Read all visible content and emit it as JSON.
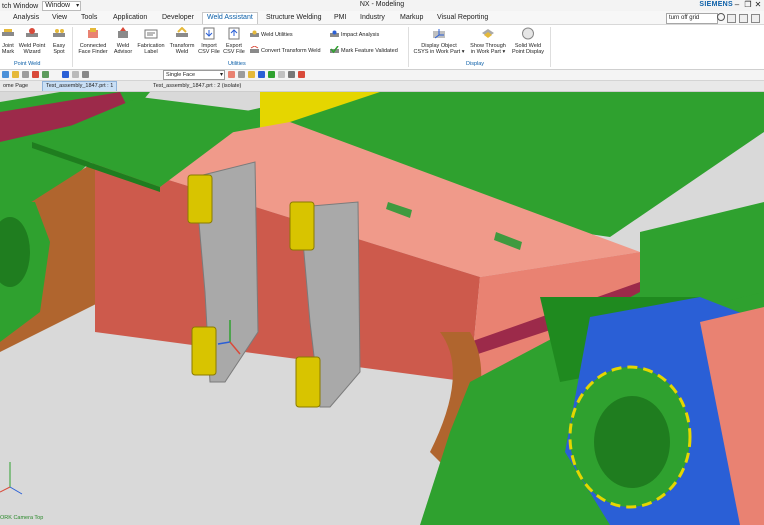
{
  "titlebar": {
    "switch_window": "tch Window",
    "window": "Window",
    "title": "NX - Modeling",
    "brand": "SIEMENS",
    "minimize": "–",
    "restore": "❐",
    "close": "✕"
  },
  "menu": {
    "tabs": [
      "Analysis",
      "View",
      "Tools",
      "Application",
      "Developer",
      "Weld Assistant",
      "Structure Welding",
      "PMI",
      "Industry",
      "Markup",
      "Visual Reporting"
    ],
    "active_index": 5,
    "search_value": "turn off grid"
  },
  "ribbon": {
    "buttons": [
      {
        "label1": "Joint",
        "label2": "Mark"
      },
      {
        "label1": "Weld Point",
        "label2": "Wizard"
      },
      {
        "label1": "Easy",
        "label2": "Spot"
      },
      {
        "label1": "Connected",
        "label2": "Face Finder"
      },
      {
        "label1": "Weld",
        "label2": "Advisor"
      },
      {
        "label1": "Fabrication",
        "label2": "Label"
      },
      {
        "label1": "Transform",
        "label2": "Weld"
      },
      {
        "label1": "Import",
        "label2": "CSV File"
      },
      {
        "label1": "Export",
        "label2": "CSV File"
      },
      {
        "label1": "Display Object",
        "label2": "CSYS in Work Part ▾"
      },
      {
        "label1": "Show Through",
        "label2": "in Work Part ▾"
      },
      {
        "label1": "Solid Weld",
        "label2": "Point Display"
      }
    ],
    "row_items": [
      "Weld Utilities",
      "Convert Transform Weld",
      "Impact Analysis",
      "Mark Feature Validated"
    ],
    "groups": [
      "Point Weld",
      "Utilities",
      "Display"
    ]
  },
  "toolbar": {
    "filter_value": "Single Face"
  },
  "doc_tabs": [
    "ome Page",
    "Test_assembly_1847.prt : 1",
    "Test_assembly_1847.prt : 2 (isolate)"
  ],
  "viewport": {
    "csys_label": "ORK Camera Top"
  },
  "colors": {
    "accent": "#0b5fa8",
    "green": "#2fa12f",
    "salmon": "#e98272",
    "gray_part": "#a9a9a9",
    "yellow": "#d8c400",
    "blue": "#2a5fd6",
    "brown": "#b0652e",
    "background": "#d9d9d9"
  }
}
